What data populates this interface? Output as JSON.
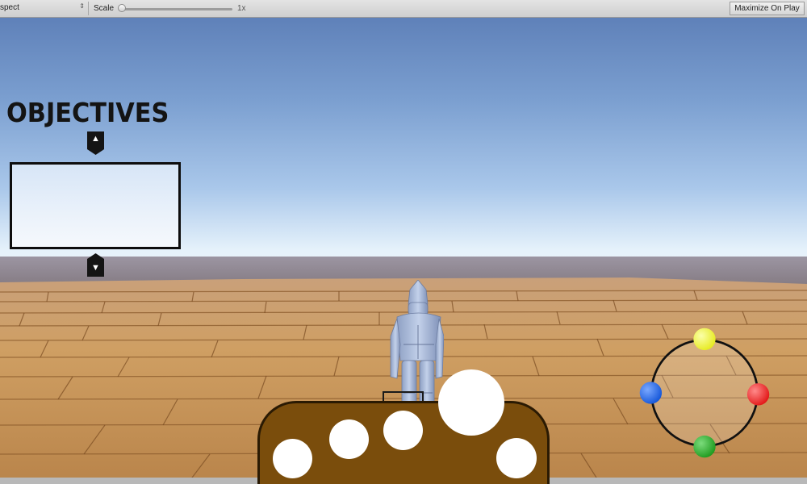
{
  "toolbar": {
    "aspect_label": "spect",
    "scale_label": "Scale",
    "scale_value": "1x",
    "maximize_label": "Maximize On Play"
  },
  "objectives": {
    "title": "OBJECTIVES",
    "up_glyph": "▲",
    "down_glyph": "▼"
  },
  "hotbar": {
    "slots": [
      "empty",
      "empty",
      "empty",
      "selected-large",
      "empty"
    ]
  },
  "color_wheel": {
    "colors": {
      "top": "#e6ea1f",
      "right": "#e21616",
      "bottom": "#1e9a1e",
      "left": "#1456d8"
    }
  },
  "colors": {
    "hotbar_fill": "#7a4d0c",
    "wood": "#c99a5d"
  }
}
